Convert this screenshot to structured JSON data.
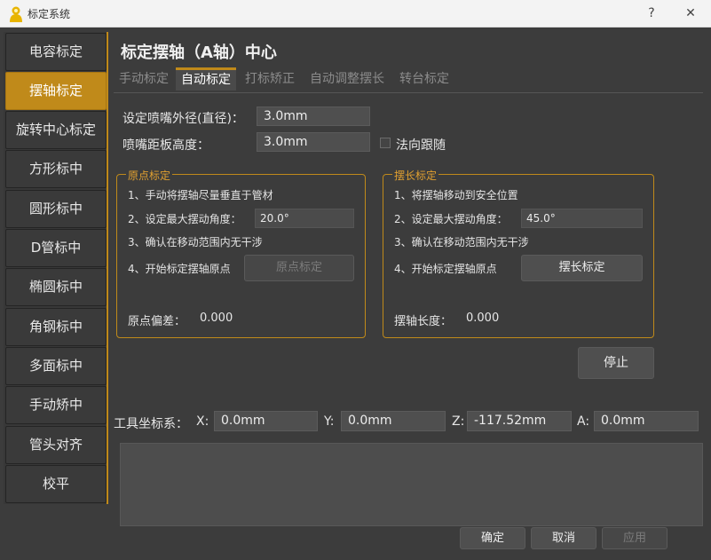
{
  "window": {
    "title": "标定系统",
    "help_label": "?",
    "close_label": "✕"
  },
  "sidebar": {
    "items": [
      {
        "label": "电容标定"
      },
      {
        "label": "摆轴标定"
      },
      {
        "label": "旋转中心标定"
      },
      {
        "label": "方形标中"
      },
      {
        "label": "圆形标中"
      },
      {
        "label": "D管标中"
      },
      {
        "label": "椭圆标中"
      },
      {
        "label": "角钢标中"
      },
      {
        "label": "多面标中"
      },
      {
        "label": "手动矫中"
      },
      {
        "label": "管头对齐"
      },
      {
        "label": "校平"
      }
    ],
    "active_index": 1
  },
  "page": {
    "title": "标定摆轴（A轴）中心"
  },
  "tabs": [
    {
      "label": "手动标定"
    },
    {
      "label": "自动标定"
    },
    {
      "label": "打标矫正"
    },
    {
      "label": "自动调整摆长"
    },
    {
      "label": "转台标定"
    }
  ],
  "settings": {
    "nozzle_diameter_label": "设定喷嘴外径(直径)：",
    "nozzle_diameter_value": "3.0mm",
    "nozzle_height_label": "喷嘴距板高度：",
    "nozzle_height_value": "3.0mm",
    "normal_follow_label": "法向跟随"
  },
  "origin_group": {
    "title": "原点标定",
    "step1": "1、手动将摆轴尽量垂直于管材",
    "step2": "2、设定最大摆动角度：",
    "step2_value": "20.0°",
    "step3": "3、确认在移动范围内无干涉",
    "step4": "4、开始标定摆轴原点",
    "button_label": "原点标定",
    "result_label": "原点偏差：",
    "result_value": "0.000"
  },
  "swing_group": {
    "title": "摆长标定",
    "step1": "1、将摆轴移动到安全位置",
    "step2": "2、设定最大摆动角度：",
    "step2_value": "45.0°",
    "step3": "3、确认在移动范围内无干涉",
    "step4": "4、开始标定摆轴原点",
    "button_label": "摆长标定",
    "result_label": "摆轴长度：",
    "result_value": "0.000"
  },
  "stop_label": "停止",
  "coords": {
    "label": "工具坐标系：",
    "x_label": "X:",
    "x_value": "0.0mm",
    "y_label": "Y:",
    "y_value": "0.0mm",
    "z_label": "Z:",
    "z_value": "-117.52mm",
    "a_label": "A:",
    "a_value": "0.0mm"
  },
  "footer": {
    "ok_label": "确定",
    "cancel_label": "取消",
    "apply_label": "应用"
  },
  "colors": {
    "accent": "#c08a1a",
    "background": "#3c3c3c"
  }
}
